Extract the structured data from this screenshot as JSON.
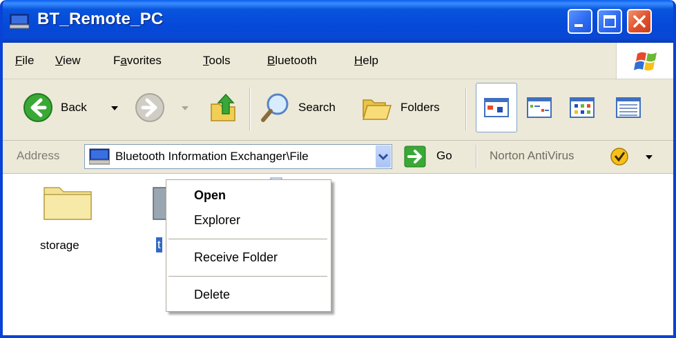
{
  "window": {
    "title": "BT_Remote_PC",
    "controls": [
      "minimize",
      "maximize",
      "close"
    ]
  },
  "menubar": {
    "items": [
      {
        "label": "File",
        "accel": "F"
      },
      {
        "label": "View",
        "accel": "V"
      },
      {
        "label": "Favorites",
        "accel": "a"
      },
      {
        "label": "Tools",
        "accel": "T"
      },
      {
        "label": "Bluetooth",
        "accel": "B"
      },
      {
        "label": "Help",
        "accel": "H"
      }
    ]
  },
  "toolbar": {
    "back_label": "Back",
    "search_label": "Search",
    "folders_label": "Folders",
    "icons": [
      "back-arrow-icon",
      "forward-arrow-icon",
      "up-folder-icon",
      "search-icon",
      "folders-icon",
      "thumbnails-view-icon",
      "tiles-view-icon",
      "icons-view-icon",
      "details-view-icon"
    ]
  },
  "addressbar": {
    "label": "Address",
    "value": "Bluetooth Information Exchanger\\File",
    "go_label": "Go",
    "norton_label": "Norton AntiVirus"
  },
  "content": {
    "items": [
      {
        "name": "storage",
        "type": "folder"
      },
      {
        "name": "t",
        "type": "folder",
        "selected": true
      }
    ]
  },
  "context_menu": {
    "items": [
      {
        "label": "Open",
        "bold": true
      },
      {
        "label": "Explorer"
      },
      {
        "label": "Receive Folder"
      },
      {
        "label": "Delete"
      }
    ]
  },
  "colors": {
    "titlebar": "#0855dd",
    "window_frame": "#0842d6",
    "close_button": "#e0512b",
    "chrome": "#ece9d8",
    "selection": "#316ac5"
  }
}
